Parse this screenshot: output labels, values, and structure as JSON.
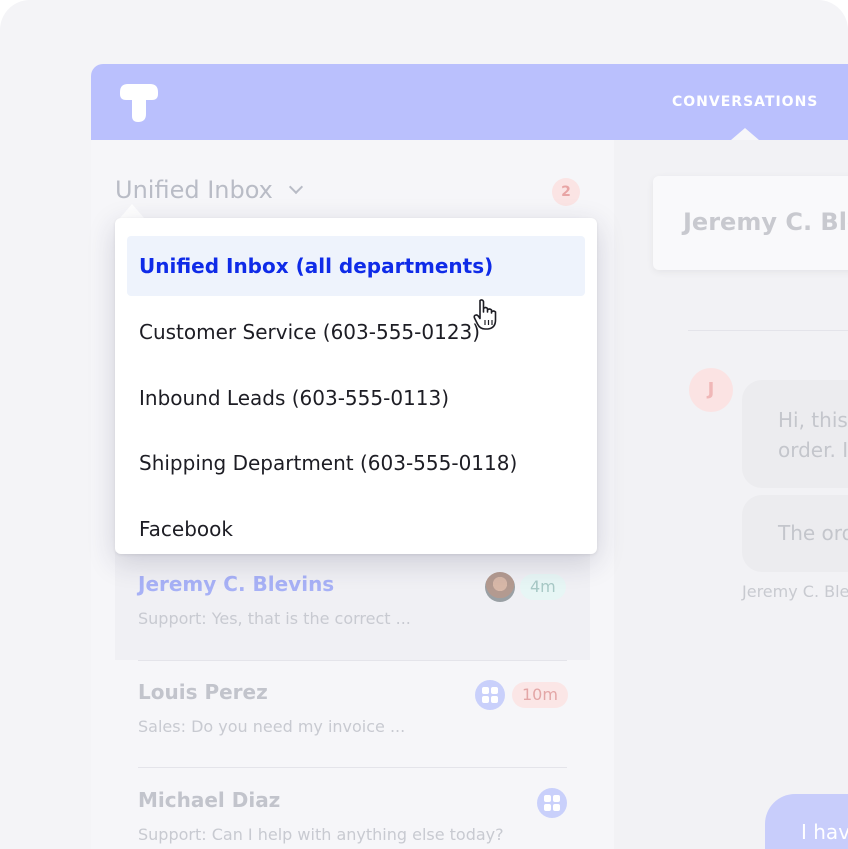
{
  "topbar": {
    "nav_conversations": "CONVERSATIONS"
  },
  "inbox": {
    "title": "Unified Inbox",
    "unread_count": "2"
  },
  "dropdown": {
    "options": [
      {
        "label": "Unified Inbox (all departments)",
        "selected": true
      },
      {
        "label": "Customer Service (603-555-0123)",
        "selected": false
      },
      {
        "label": "Inbound Leads (603-555-0113)",
        "selected": false
      },
      {
        "label": "Shipping Department (603-555-0118)",
        "selected": false
      },
      {
        "label": "Facebook",
        "selected": false
      }
    ]
  },
  "conversations": [
    {
      "name": "Jeremy C. Blevins",
      "snippet": "Support: Yes, that is the correct ...",
      "time": "4m",
      "avatar": "user-photo",
      "active": true
    },
    {
      "name": "Louis Perez",
      "snippet": "Sales: Do you need my invoice ...",
      "time": "10m",
      "avatar": "department-icon",
      "active": false
    },
    {
      "name": "Michael Diaz",
      "snippet": "Support: Can I help with anything else today?",
      "time": "",
      "avatar": "department-icon",
      "active": false
    }
  ],
  "thread": {
    "contact_name": "Jeremy C. Blevins",
    "avatar_initial": "J",
    "messages": [
      {
        "lines": [
          "Hi, this is about my",
          "order. I need to"
        ]
      },
      {
        "lines": [
          "The order number"
        ]
      }
    ],
    "message_meta": "Jeremy C. Blevins",
    "reply_text": "I have"
  },
  "colors": {
    "topbar": "#bac0fd",
    "selected_option_text": "#0f2be8",
    "selected_option_bg": "#eef3fc"
  }
}
